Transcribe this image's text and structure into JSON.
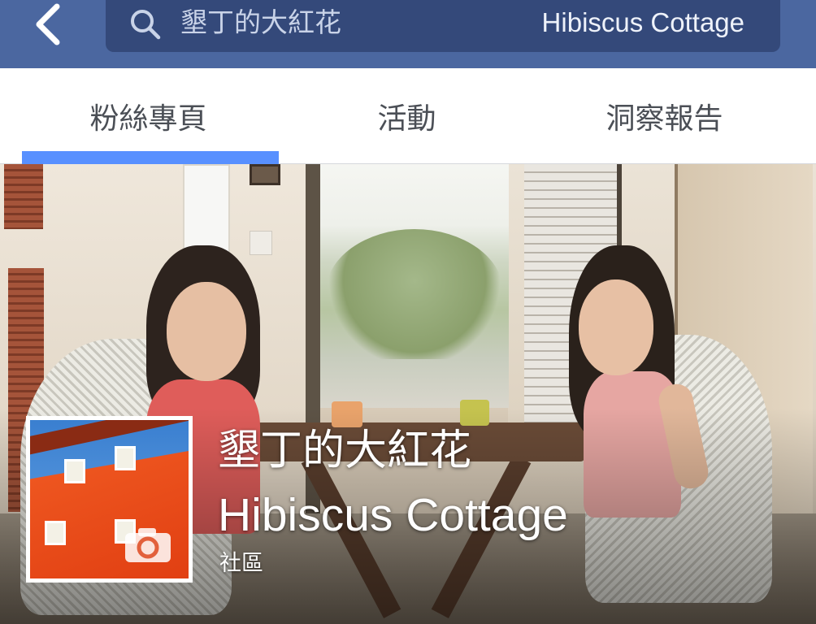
{
  "nav": {
    "back_icon": "chevron-left-icon",
    "search_icon": "search-icon",
    "title_zh": "墾丁的大紅花",
    "title_en": "Hibiscus Cottage"
  },
  "tabs": [
    {
      "label": "粉絲專頁",
      "active": true
    },
    {
      "label": "活動",
      "active": false
    },
    {
      "label": "洞察報告",
      "active": false
    }
  ],
  "page": {
    "name_zh": "墾丁的大紅花",
    "name_en": "Hibiscus Cottage",
    "category": "社區",
    "camera_icon": "camera-icon"
  },
  "colors": {
    "nav_background": "#4b67a0",
    "search_background": "#34497a",
    "tab_indicator": "#5890ff",
    "tab_text": "#4b4f56"
  }
}
